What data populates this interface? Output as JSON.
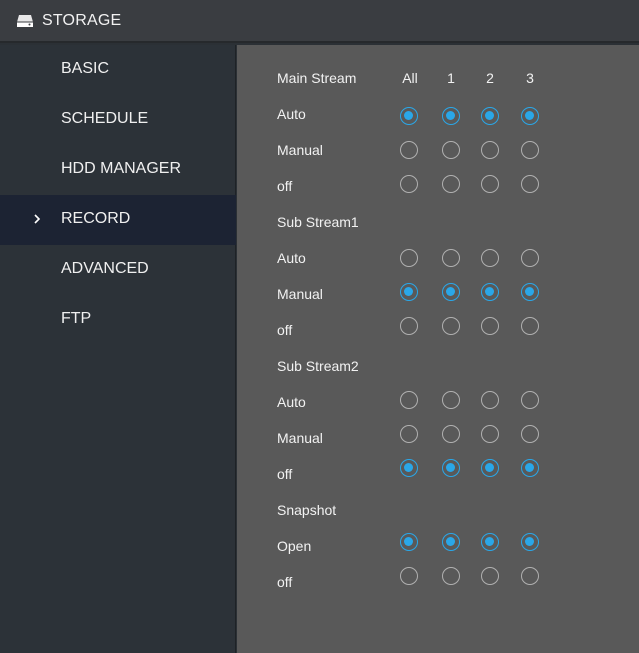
{
  "header": {
    "title": "STORAGE",
    "icon": "hdd-icon"
  },
  "sidebar": {
    "items": [
      {
        "label": "BASIC"
      },
      {
        "label": "SCHEDULE"
      },
      {
        "label": "HDD MANAGER"
      },
      {
        "label": "RECORD",
        "active": true
      },
      {
        "label": "ADVANCED"
      },
      {
        "label": "FTP"
      }
    ]
  },
  "colors": {
    "accent": "#2aa7e8",
    "sidebar_active": "#1c2333",
    "panel": "#595959"
  },
  "main": {
    "columns": [
      "All",
      "1",
      "2",
      "3"
    ],
    "sections": [
      {
        "title": "Main Stream",
        "rows": [
          {
            "label": "Auto",
            "selected": [
              true,
              true,
              true,
              true
            ]
          },
          {
            "label": "Manual",
            "selected": [
              false,
              false,
              false,
              false
            ]
          },
          {
            "label": "off",
            "selected": [
              false,
              false,
              false,
              false
            ]
          }
        ]
      },
      {
        "title": "Sub Stream1",
        "rows": [
          {
            "label": "Auto",
            "selected": [
              false,
              false,
              false,
              false
            ]
          },
          {
            "label": "Manual",
            "selected": [
              true,
              true,
              true,
              true
            ]
          },
          {
            "label": "off",
            "selected": [
              false,
              false,
              false,
              false
            ]
          }
        ]
      },
      {
        "title": "Sub Stream2",
        "rows": [
          {
            "label": "Auto",
            "selected": [
              false,
              false,
              false,
              false
            ]
          },
          {
            "label": "Manual",
            "selected": [
              false,
              false,
              false,
              false
            ]
          },
          {
            "label": "off",
            "selected": [
              true,
              true,
              true,
              true
            ]
          }
        ]
      },
      {
        "title": "Snapshot",
        "rows": [
          {
            "label": "Open",
            "selected": [
              true,
              true,
              true,
              true
            ]
          },
          {
            "label": "off",
            "selected": [
              false,
              false,
              false,
              false
            ]
          }
        ]
      }
    ]
  }
}
